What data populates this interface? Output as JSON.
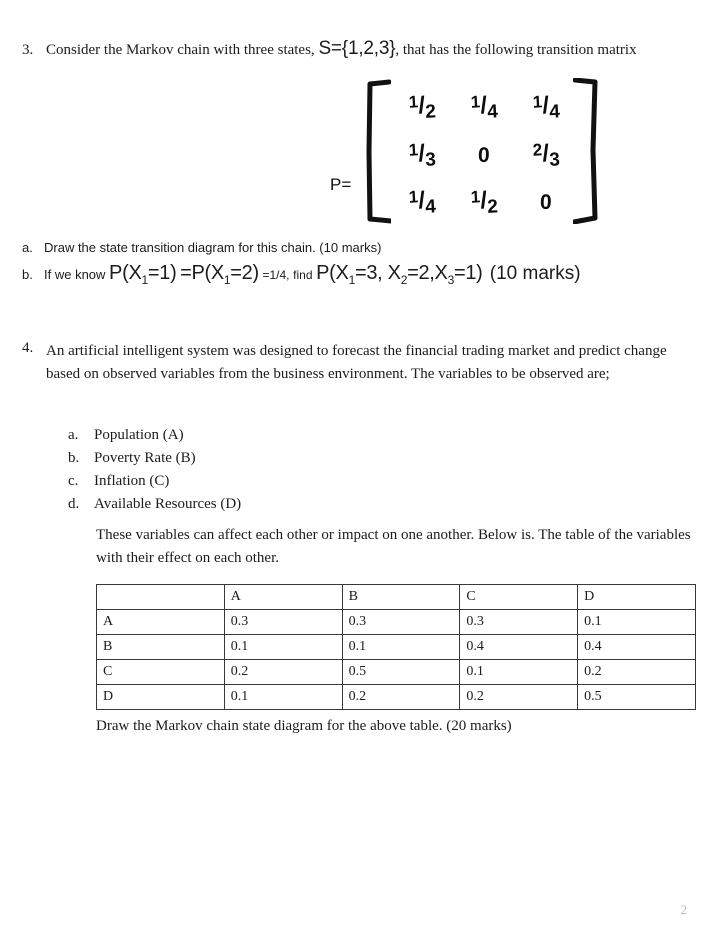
{
  "page": {
    "number": "2"
  },
  "question3": {
    "number": "3.",
    "text_before": "Consider the Markov chain with three states,",
    "state_set": "S={1,2,3}",
    "text_after": ", that has the following transition matrix",
    "matrix": {
      "label": "P=",
      "rows": [
        [
          "1/2",
          "1/4",
          "1/4"
        ],
        [
          "1/3",
          "0",
          "2/3"
        ],
        [
          "1/4",
          "1/2",
          "0"
        ]
      ],
      "cells": [
        [
          {
            "num": "1",
            "den": "2",
            "zero": false
          },
          {
            "num": "1",
            "den": "4",
            "zero": false
          },
          {
            "num": "1",
            "den": "4",
            "zero": false
          }
        ],
        [
          {
            "num": "1",
            "den": "3",
            "zero": false
          },
          {
            "num": "",
            "den": "",
            "zero": true,
            "text": "0"
          },
          {
            "num": "2",
            "den": "3",
            "zero": false
          }
        ],
        [
          {
            "num": "1",
            "den": "4",
            "zero": false
          },
          {
            "num": "1",
            "den": "2",
            "zero": false
          },
          {
            "num": "",
            "den": "",
            "zero": true,
            "text": "0"
          }
        ]
      ]
    },
    "parts": [
      {
        "letter": "a.",
        "text": "Draw the state transition diagram for this chain. (10 marks)"
      },
      {
        "letter": "b.",
        "lead": "If we know",
        "expr1": "P(X",
        "sub1": "1",
        "expr1b": "=1)",
        "expr2": "=P(X",
        "sub2": "1",
        "expr2b": "=2)",
        "eq_value": "=1/4,",
        "find": "find",
        "expr3": "P(X",
        "sub3": "1",
        "expr3b": "=3, X",
        "sub4": "2",
        "expr4b": "=2,X",
        "sub5": "3",
        "expr5b": "=1)",
        "marks": "(10 marks)"
      }
    ]
  },
  "question4": {
    "number": "4.",
    "paragraph": "An artificial intelligent system was designed to forecast the financial trading market and predict change based on observed variables from the business environment. The variables to be observed are;",
    "variables": [
      {
        "letter": "a.",
        "label": "Population (A)"
      },
      {
        "letter": "b.",
        "label": "Poverty Rate (B)"
      },
      {
        "letter": "c.",
        "label": "Inflation (C)"
      },
      {
        "letter": "d.",
        "label": "Available Resources (D)"
      }
    ],
    "table_intro": "These variables can affect each other or impact on one another. Below is. The table of the variables with their effect on each other.",
    "table": {
      "headers": [
        "",
        "A",
        "B",
        "C",
        "D"
      ],
      "rows": [
        {
          "label": "A",
          "values": [
            "0.3",
            "0.3",
            "0.3",
            "0.1"
          ]
        },
        {
          "label": "B",
          "values": [
            "0.1",
            "0.1",
            "0.4",
            "0.4"
          ]
        },
        {
          "label": "C",
          "values": [
            "0.2",
            "0.5",
            "0.1",
            "0.2"
          ]
        },
        {
          "label": "D",
          "values": [
            "0.1",
            "0.2",
            "0.2",
            "0.5"
          ]
        }
      ]
    },
    "closing": "Draw the Markov chain state diagram for the above table. (20 marks)"
  }
}
